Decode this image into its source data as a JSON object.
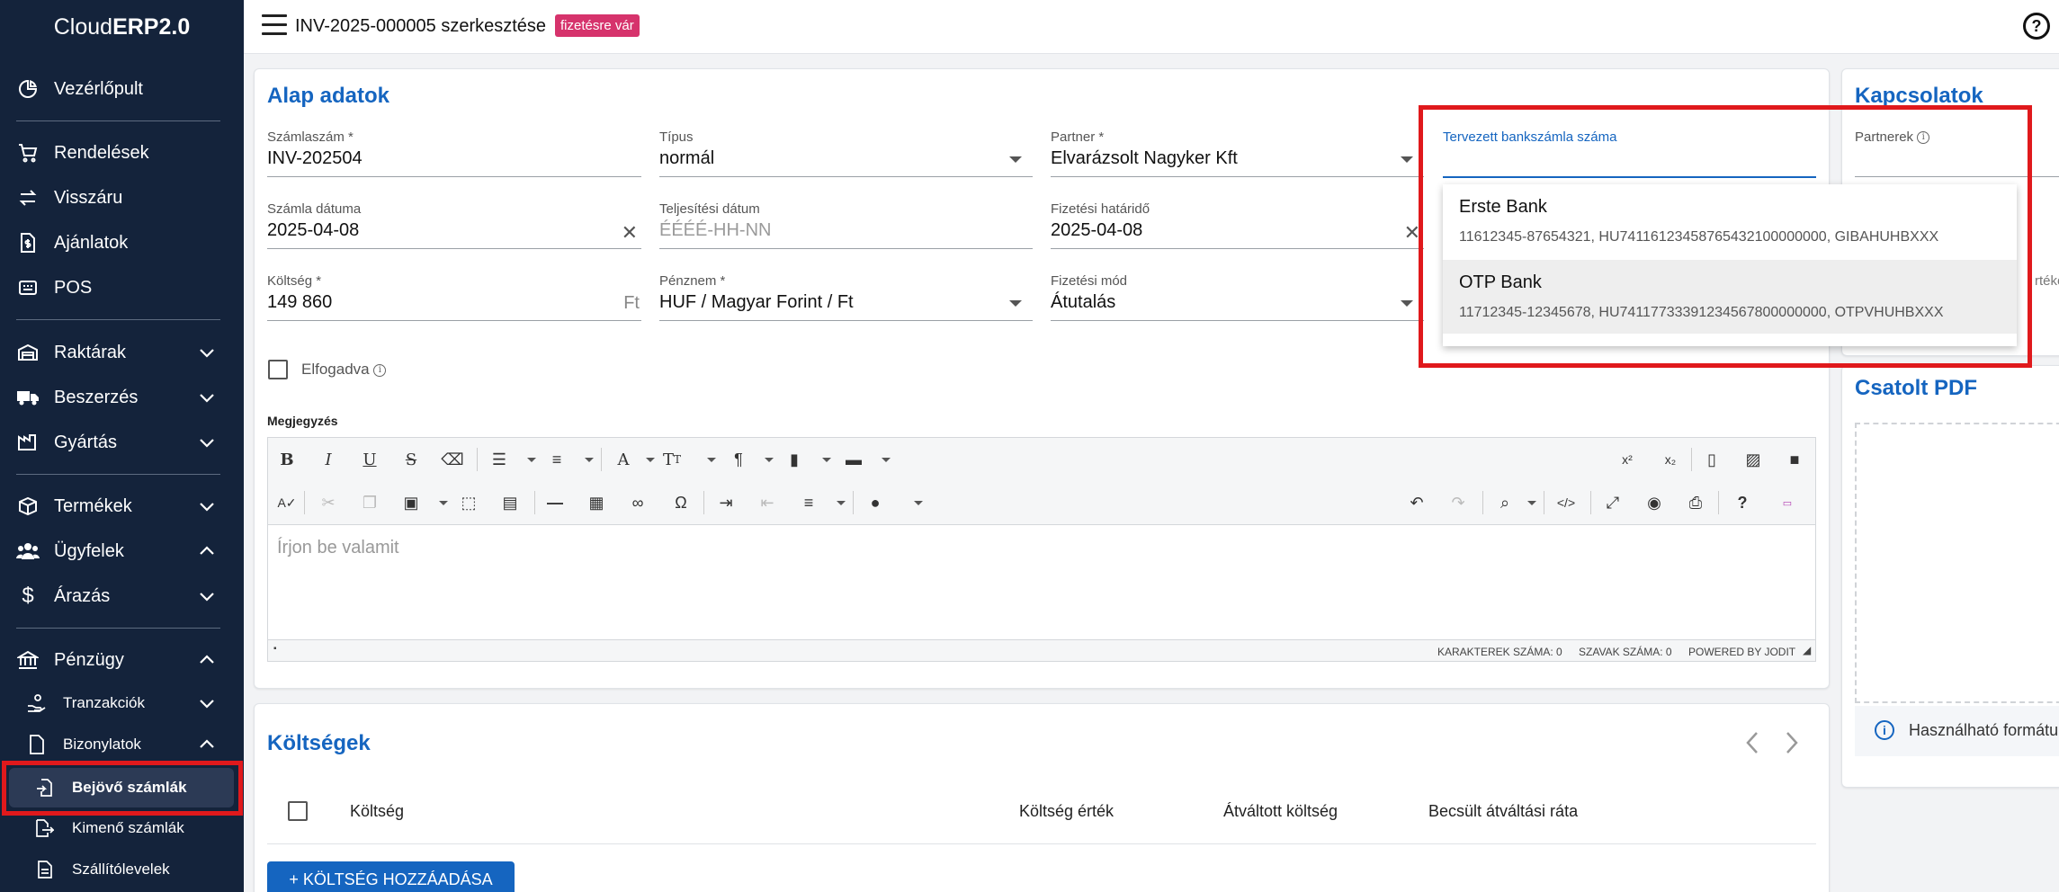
{
  "brand": {
    "name": "Cloud",
    "name_bold": "ERP",
    "version": " 2.0"
  },
  "sidebar": {
    "items": [
      {
        "label": "Vezérlőpult",
        "icon": "dashboard-icon"
      },
      {
        "label": "Rendelések",
        "icon": "cart-icon"
      },
      {
        "label": "Visszáru",
        "icon": "swap-icon"
      },
      {
        "label": "Ajánlatok",
        "icon": "document-dollar-icon"
      },
      {
        "label": "POS",
        "icon": "pos-icon"
      },
      {
        "label": "Raktárak",
        "icon": "warehouse-icon"
      },
      {
        "label": "Beszerzés",
        "icon": "truck-icon"
      },
      {
        "label": "Gyártás",
        "icon": "factory-icon"
      },
      {
        "label": "Termékek",
        "icon": "box-icon"
      },
      {
        "label": "Ügyfelek",
        "icon": "users-icon"
      },
      {
        "label": "Árazás",
        "icon": "dollar-icon"
      },
      {
        "label": "Pénzügy",
        "icon": "bank-icon"
      },
      {
        "label": "Tranzakciók",
        "icon": "hand-coin-icon"
      },
      {
        "label": "Bizonylatok",
        "icon": "file-icon"
      },
      {
        "label": "Bejövő számlák",
        "icon": "file-import-icon"
      },
      {
        "label": "Kimenő számlák",
        "icon": "file-export-icon"
      },
      {
        "label": "Szállítólevelek",
        "icon": "file-list-icon"
      }
    ]
  },
  "header": {
    "title": "INV-2025-000005 szerkesztése",
    "status_badge": "fizetésre vár"
  },
  "basic": {
    "title": "Alap adatok",
    "invoice_number": {
      "label": "Számlaszám *",
      "value": "INV-202504"
    },
    "type": {
      "label": "Típus",
      "value": "normál"
    },
    "partner": {
      "label": "Partner *",
      "value": "Elvarázsolt Nagyker Kft"
    },
    "planned_bank": {
      "label": "Tervezett bankszámla száma",
      "value": ""
    },
    "invoice_date": {
      "label": "Számla dátuma",
      "value": "2025-04-08"
    },
    "fulfillment_date": {
      "label": "Teljesítési dátum",
      "placeholder": "ÉÉÉÉ-HH-NN"
    },
    "due_date": {
      "label": "Fizetési határidő",
      "value": "2025-04-08"
    },
    "cost": {
      "label": "Költség *",
      "value": "149 860",
      "suffix": "Ft"
    },
    "currency": {
      "label": "Pénznem *",
      "value": "HUF / Magyar Forint / Ft"
    },
    "payment_method": {
      "label": "Fizetési mód",
      "value": "Átutalás"
    },
    "accepted_label": "Elfogadva",
    "note_label": "Megjegyzés",
    "editor_placeholder": "Írjon be valamit",
    "editor_status": {
      "chars": "KARAKTEREK SZÁMA: 0",
      "words": "SZAVAK SZÁMA: 0",
      "powered": "POWERED BY JODIT"
    }
  },
  "bank_options": [
    {
      "name": "Erste Bank",
      "detail": "11612345-87654321, HU74116123458765432100000000, GIBAHUHBXXX"
    },
    {
      "name": "OTP Bank",
      "detail": "11712345-12345678, HU74117733391234567800000000, OTPVHUHBXXX"
    }
  ],
  "relations": {
    "title": "Kapcsolatok",
    "partners_label": "Partnerek",
    "partial_label": "rtéke"
  },
  "pdf": {
    "title": "Csatolt PDF",
    "info": "Használható formátu"
  },
  "costs": {
    "title": "Költségek",
    "columns": [
      "Költség",
      "Költség érték",
      "Átváltott költség",
      "Becsült átváltási ráta"
    ],
    "add_button": "+ KÖLTSÉG HOZZÁADÁSA"
  },
  "colors": {
    "sidebar": "#14233b",
    "accent": "#1565c0",
    "badge": "#d6336c",
    "highlight": "#e0191c"
  }
}
